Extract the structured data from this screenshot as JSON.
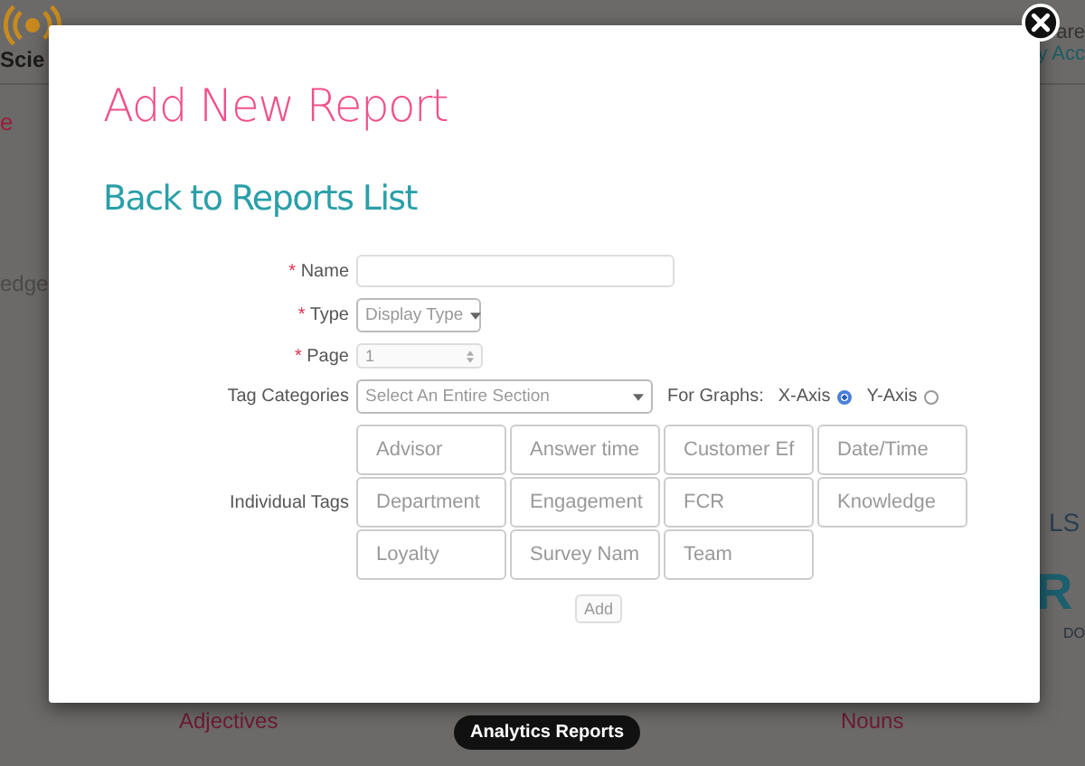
{
  "background": {
    "logo_text": "Scie",
    "header_right": [
      "are",
      "y Acc"
    ],
    "left_fragments": [
      "e",
      "edge"
    ],
    "right_fragments": [
      "LS",
      "R",
      "DO"
    ],
    "columns": [
      "Adjectives",
      "Nouns"
    ],
    "pill": "Analytics Reports"
  },
  "dialog": {
    "title": "Add New Report",
    "back_link": "Back to Reports List",
    "fields": [
      {
        "kind": "text",
        "label": "Name",
        "required_mark": "*"
      },
      {
        "kind": "select",
        "label": "Type",
        "required_mark": "*",
        "placeholder": "Display Type"
      },
      {
        "kind": "number",
        "label": "Page",
        "required_mark": "*",
        "value": "1"
      }
    ],
    "tag_categories": {
      "label": "Tag Categories",
      "placeholder": "Select An Entire Section",
      "graphs_label": "For Graphs:",
      "axes": [
        {
          "label": "X-Axis",
          "selected": true
        },
        {
          "label": "Y-Axis",
          "selected": false
        }
      ]
    },
    "individual_tags": {
      "label": "Individual Tags",
      "tags": [
        "Advisor",
        "Answer time",
        "Customer Ef",
        "Date/Time",
        "Department",
        "Engagement",
        "FCR",
        "Knowledge",
        "Loyalty",
        "Survey Nam",
        "Team"
      ]
    },
    "add_button": "Add"
  }
}
